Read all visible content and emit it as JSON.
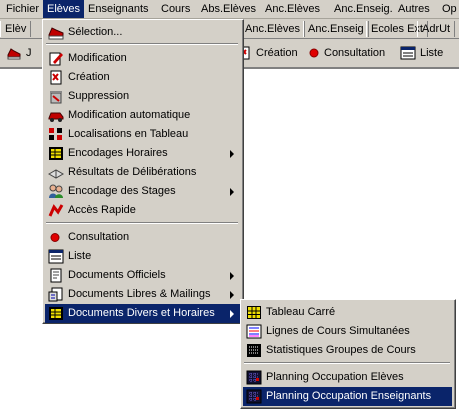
{
  "menubar": {
    "items": [
      {
        "label": "Fichier",
        "active": false
      },
      {
        "label": "Elèves",
        "active": true
      },
      {
        "label": "Enseignants",
        "active": false
      },
      {
        "label": "Cours",
        "active": false
      },
      {
        "label": "Abs.Elèves",
        "active": false
      },
      {
        "label": "Anc.Elèves",
        "active": false
      },
      {
        "label": "Anc.Enseig.",
        "active": false
      },
      {
        "label": "Autres",
        "active": false
      },
      {
        "label": "Op",
        "active": false
      }
    ]
  },
  "tabs": {
    "items": [
      "Elèv",
      "Anc.Elèves",
      "Anc.Enseig",
      "Ecoles Ext",
      "AdrUt"
    ]
  },
  "toolbar": {
    "items": [
      "J",
      "Création",
      "Consultation",
      "Liste"
    ]
  },
  "eleves_menu": {
    "items": [
      {
        "label": "Sélection...",
        "icon": "shoe-icon",
        "submenu": false
      },
      {
        "label": "Modification",
        "icon": "edit-pencil-icon",
        "submenu": false
      },
      {
        "label": "Création",
        "icon": "new-document-icon",
        "submenu": false
      },
      {
        "label": "Suppression",
        "icon": "trash-icon",
        "submenu": false
      },
      {
        "label": "Modification automatique",
        "icon": "car-icon",
        "submenu": false
      },
      {
        "label": "Localisations en Tableau",
        "icon": "grid-locate-icon",
        "submenu": false
      },
      {
        "label": "Encodages Horaires",
        "icon": "schedule-icon",
        "submenu": true
      },
      {
        "label": "Résultats de Délibérations",
        "icon": "book-icon",
        "submenu": false
      },
      {
        "label": "Encodage des Stages",
        "icon": "people-icon",
        "submenu": true
      },
      {
        "label": "Accès Rapide",
        "icon": "quick-access-icon",
        "submenu": false
      },
      {
        "label": "Consultation",
        "icon": "red-dot-icon",
        "submenu": false
      },
      {
        "label": "Liste",
        "icon": "list-icon",
        "submenu": false
      },
      {
        "label": "Documents Officiels",
        "icon": "document-icon",
        "submenu": true
      },
      {
        "label": "Documents Libres  & Mailings",
        "icon": "mailing-icon",
        "submenu": true
      },
      {
        "label": "Documents Divers et Horaires",
        "icon": "schedule-icon",
        "submenu": true
      }
    ]
  },
  "documents_submenu": {
    "items": [
      {
        "label": "Tableau Carré",
        "icon": "grid-yellow-icon"
      },
      {
        "label": "Lignes de Cours Simultanées",
        "icon": "lines-icon"
      },
      {
        "label": "Statistiques Groupes de Cours",
        "icon": "stats-grid-icon"
      },
      {
        "label": "Planning Occupation Elèves",
        "icon": "planning-icon"
      },
      {
        "label": "Planning Occupation Enseignants",
        "icon": "planning-icon"
      }
    ]
  },
  "colors": {
    "highlight": "#0a246a",
    "menu_bg": "#d4d0c8"
  }
}
